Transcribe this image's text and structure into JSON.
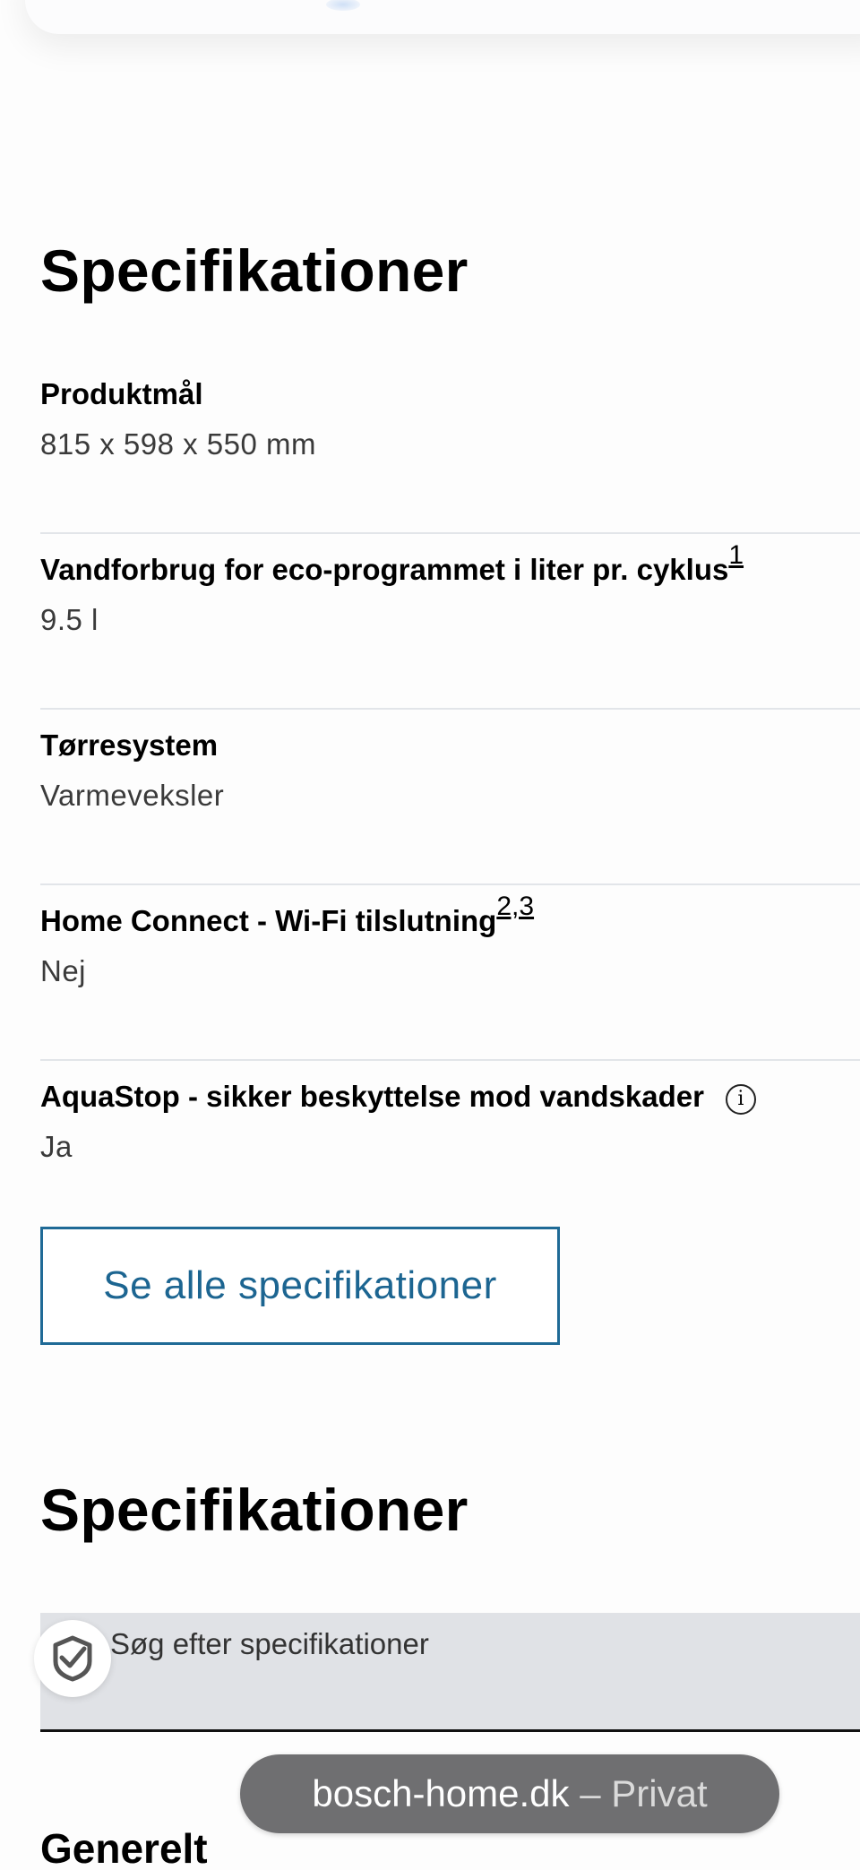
{
  "specs_section": {
    "title": "Specifikationer",
    "items": [
      {
        "label": "Produktmål",
        "value": "815 x 598 x 550 mm",
        "footnote": ""
      },
      {
        "label": "Vandforbrug for eco-programmet i liter pr. cyklus",
        "value": "9.5 l",
        "footnote": "1"
      },
      {
        "label": "Tørresystem",
        "value": "Varmeveksler",
        "footnote": ""
      },
      {
        "label": "Home Connect - Wi-Fi tilslutning",
        "value": "Nej",
        "footnote": "2,3"
      },
      {
        "label": "AquaStop - sikker beskyttelse mod vandskader",
        "value": "Ja",
        "footnote": ""
      }
    ],
    "see_all_label": "Se alle specifikationer"
  },
  "full_specs_section": {
    "title": "Specifikationer",
    "search": {
      "placeholder": "Søg efter specifikationer"
    },
    "group_heading": "Generelt"
  },
  "browser": {
    "domain": "bosch-home.dk",
    "separator": " – ",
    "mode": "Privat"
  },
  "colors": {
    "accent": "#1c6591",
    "search_bg": "#e0e2e6",
    "pill_bg": "#6f6f71"
  }
}
